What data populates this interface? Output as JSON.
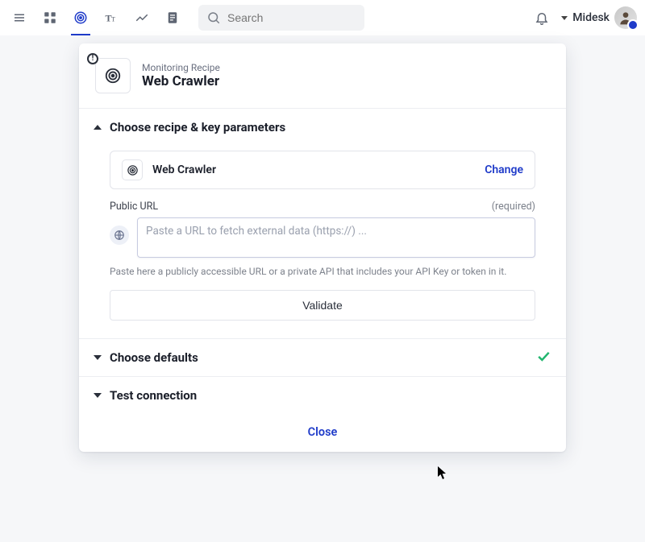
{
  "nav": {
    "search_placeholder": "Search",
    "user_name": "Midesk"
  },
  "modal": {
    "subheading": "Monitoring Recipe",
    "heading": "Web Crawler",
    "section1": {
      "title": "Choose recipe & key parameters",
      "recipe_name": "Web Crawler",
      "change_label": "Change",
      "url_label": "Public URL",
      "url_required": "(required)",
      "url_placeholder": "Paste a URL to fetch external data (https://) ...",
      "url_hint": "Paste here a publicly accessible URL or a private API that includes your API Key or token in it.",
      "validate_label": "Validate"
    },
    "section2": {
      "title": "Choose defaults"
    },
    "section3": {
      "title": "Test connection"
    },
    "close_label": "Close"
  }
}
